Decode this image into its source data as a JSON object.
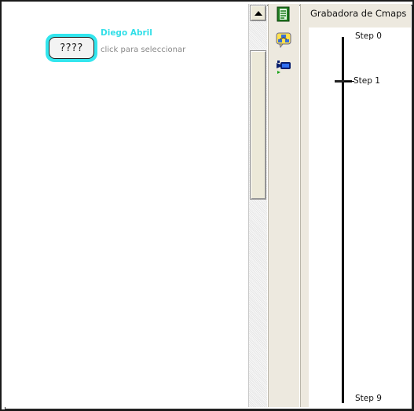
{
  "canvas": {
    "node_label": "????",
    "author": "Diego Abril",
    "hint": "click para seleccionar"
  },
  "sidebar_icons": [
    "list-icon",
    "network-icon",
    "camera-icon"
  ],
  "recorder": {
    "title": "Grabadora de Cmaps",
    "steps": [
      "Step 0",
      "Step 1",
      "Step 9"
    ]
  },
  "colors": {
    "node_border": "#33e6ee",
    "author_text": "#33dfe8"
  }
}
